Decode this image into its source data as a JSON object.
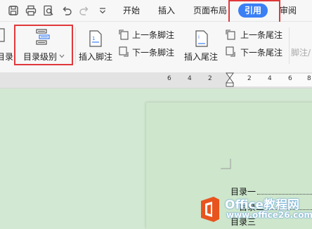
{
  "tabs": [
    {
      "label": "开始"
    },
    {
      "label": "插入"
    },
    {
      "label": "页面布局"
    },
    {
      "label": "引用",
      "active": true
    },
    {
      "label": "审阅"
    }
  ],
  "ribbon": {
    "toc_partial_label": "目录",
    "toc_level_label": "目录级别",
    "insert_footnote_label": "插入脚注",
    "prev_footnote_label": "上一条脚注",
    "next_footnote_label": "下一条脚注",
    "insert_endnote_label": "插入尾注",
    "prev_endnote_label": "上一条尾注",
    "next_endnote_label": "下一条尾注",
    "footnote_endnote_sep_label": "脚注/"
  },
  "ruler": {
    "left_ticks": [
      "6",
      "4",
      "2"
    ],
    "right_ticks": [
      "2",
      "4",
      "6",
      "8"
    ]
  },
  "document": {
    "toc_lines": [
      "目录一",
      "目录二",
      "目录三"
    ]
  },
  "watermark": {
    "title": "Office教程网",
    "url": "www.office26.com"
  },
  "colors": {
    "accent": "#3b7ff5",
    "highlight_box": "#e1383a",
    "doc_background": "#d3e8d2",
    "page_background": "#cde6cc"
  },
  "icons": {
    "quick_access": [
      "save-icon",
      "print-icon",
      "print-preview-icon",
      "undo-icon",
      "redo-icon",
      "customize-dropdown-icon"
    ]
  }
}
